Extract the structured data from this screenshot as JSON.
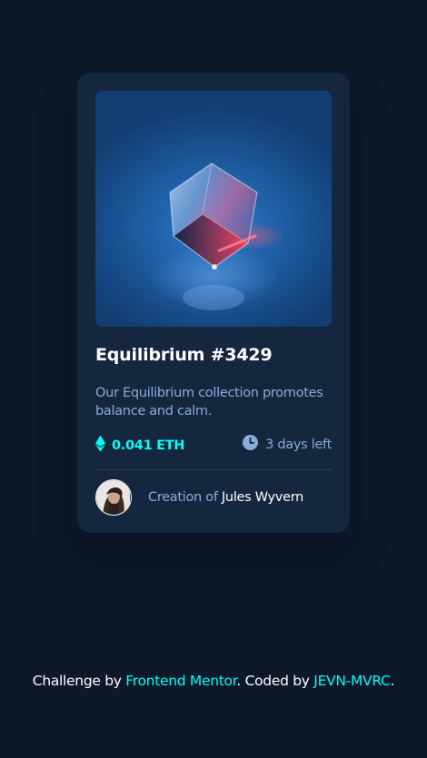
{
  "card": {
    "image_alt": "Equilibrium",
    "title": "Equilibrium #3429",
    "description": "Our Equilibrium collection promotes balance and calm.",
    "price": "0.041 ETH",
    "price_icon": "ethereum-icon",
    "time_left": "3 days left",
    "time_icon": "clock-icon",
    "creator_prefix": "Creation of ",
    "creator_name": "Jules Wyvern"
  },
  "footer": {
    "prefix": "Challenge by ",
    "link1": "Frontend Mentor",
    "middle": ". Coded by ",
    "link2": "JEVN-MVRC",
    "suffix": "."
  },
  "colors": {
    "background": "#0d1829",
    "card": "#15263f",
    "accent": "#00fff8",
    "muted_text": "#8bacd9",
    "white": "#ffffff"
  }
}
